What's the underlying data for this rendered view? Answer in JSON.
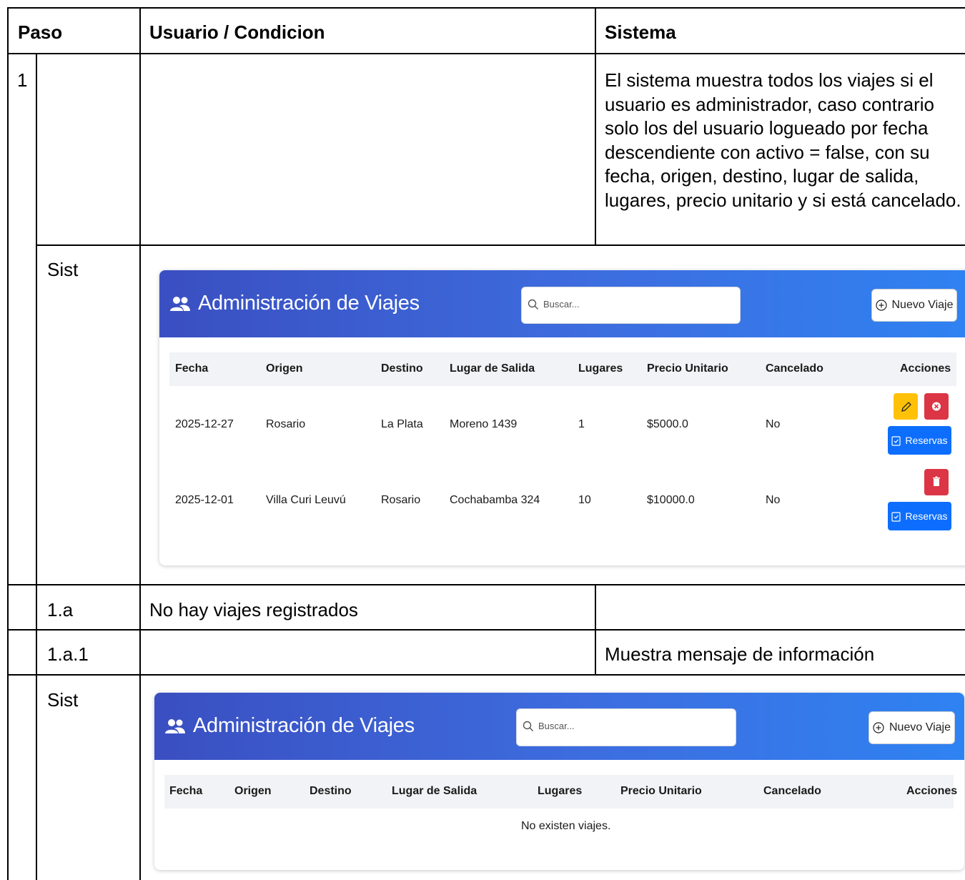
{
  "table": {
    "headers": {
      "paso": "Paso",
      "usuario": "Usuario / Condicion",
      "sistema": "Sistema"
    },
    "rows": [
      {
        "paso": "1",
        "sistema": "El sistema muestra todos los viajes si el usuario es administrador, caso contrario solo los del usuario logueado por fecha descendiente con activo = false, con su fecha, origen, destino, lugar de salida, lugares, precio unitario y si está cancelado."
      },
      {
        "label": "Sist"
      },
      {
        "label": "1.a",
        "usuario": "No hay viajes registrados"
      },
      {
        "label": "1.a.1",
        "sistema": "Muestra mensaje de información"
      },
      {
        "label": "Sist"
      }
    ]
  },
  "app": {
    "title": "Administración de Viajes",
    "search_placeholder": "Buscar...",
    "new_button": "Nuevo Viaje",
    "columns": [
      "Fecha",
      "Origen",
      "Destino",
      "Lugar de Salida",
      "Lugares",
      "Precio Unitario",
      "Cancelado",
      "Acciones"
    ],
    "trips": [
      {
        "fecha": "2025-12-27",
        "origen": "Rosario",
        "destino": "La Plata",
        "lugar": "Moreno 1439",
        "lugares": "1",
        "precio": "$5000.0",
        "cancelado": "No"
      },
      {
        "fecha": "2025-12-01",
        "origen": "Villa Curi Leuvú",
        "destino": "Rosario",
        "lugar": "Cochabamba 324",
        "lugares": "10",
        "precio": "$10000.0",
        "cancelado": "No"
      }
    ],
    "reservas_label": "Reservas",
    "empty_message": "No existen viajes."
  },
  "colors": {
    "header_start": "#3a4fc1",
    "header_end": "#2f82f2",
    "edit": "#ffc107",
    "danger": "#dc3545",
    "primary": "#0d6efd"
  }
}
